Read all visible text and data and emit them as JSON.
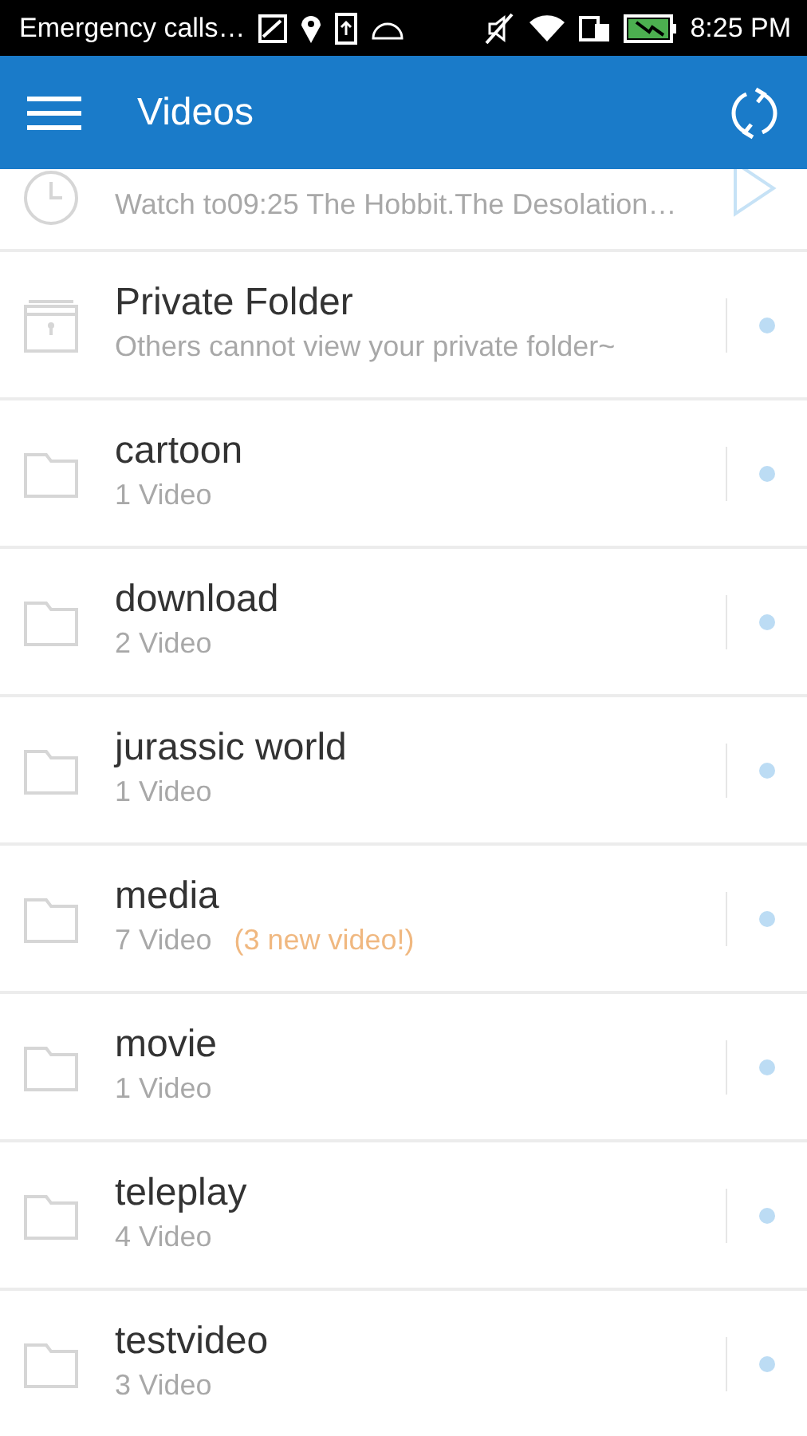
{
  "status_bar": {
    "carrier": "Emergency calls…",
    "time": "8:25 PM"
  },
  "app_bar": {
    "title": "Videos"
  },
  "items": [
    {
      "kind": "history",
      "subtitle": "Watch to09:25 The Hobbit.The Desolation…"
    },
    {
      "kind": "private",
      "title": "Private Folder",
      "subtitle": "Others cannot view your private folder~"
    },
    {
      "kind": "folder",
      "title": "cartoon",
      "subtitle": "1 Video"
    },
    {
      "kind": "folder",
      "title": "download",
      "subtitle": "2 Video"
    },
    {
      "kind": "folder",
      "title": "jurassic world",
      "subtitle": "1 Video"
    },
    {
      "kind": "folder",
      "title": "media",
      "subtitle": "7 Video",
      "note": "(3 new video!)"
    },
    {
      "kind": "folder",
      "title": "movie",
      "subtitle": "1 Video"
    },
    {
      "kind": "folder",
      "title": "teleplay",
      "subtitle": "4 Video"
    },
    {
      "kind": "folder",
      "title": "testvideo",
      "subtitle": "3 Video"
    }
  ]
}
